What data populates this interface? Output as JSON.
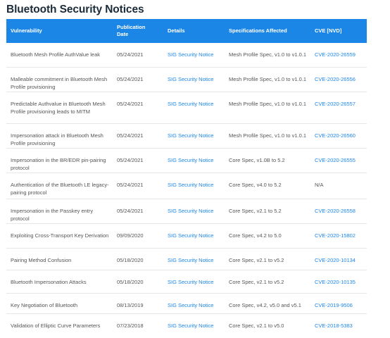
{
  "page": {
    "title": "Bluetooth Security Notices"
  },
  "table": {
    "headers": {
      "vulnerability": "Vulnerability",
      "publication_date": "Publication\nDate",
      "details": "Details",
      "specifications": "Specifications Affected",
      "cve": "CVE [NVD]"
    },
    "rows": [
      {
        "vulnerability": "Bluetooth Mesh Profile AuthValue leak",
        "date": "05/24/2021",
        "details": "SIG Security Notice",
        "spec": "Mesh Profile Spec, v1.0 to v1.0.1",
        "cve": "CVE-2020-26559"
      },
      {
        "vulnerability": "Malleable commitment in Bluetooth Mesh Profile provisioning",
        "date": "05/24/2021",
        "details": "SIG Security Notice",
        "spec": "Mesh Profile Spec, v1.0 to v1.0.1",
        "cve": "CVE-2020-26556"
      },
      {
        "vulnerability": "Predictable Authvalue in Bluetooth Mesh Profile provisioning leads to MITM",
        "date": "05/24/2021",
        "details": "SIG Security Notice",
        "spec": "Mesh Profile Spec, v1.0 to v1.0.1",
        "cve": "CVE-2020-26557"
      },
      {
        "vulnerability": "Impersonation attack in Bluetooth Mesh Profile provisioning",
        "date": "05/24/2021",
        "details": "SIG Security Notice",
        "spec": "Mesh Profile Spec, v1.0 to v1.0.1",
        "cve": "CVE-2020-26560"
      },
      {
        "vulnerability": "Impersonation in the BR/EDR pin-pairing protocol",
        "date": "05/24/2021",
        "details": "SIG Security Notice",
        "spec": "Core Spec, v1.0B to 5.2",
        "cve": "CVE-2020-26555"
      },
      {
        "vulnerability": "Authentication of the Bluetooth LE legacy-pairing protocol",
        "date": "05/24/2021",
        "details": "SIG Security Notice",
        "spec": "Core Spec, v4.0 to 5.2",
        "cve": "N/A"
      },
      {
        "vulnerability": "Impersonation in the Passkey entry protocol",
        "date": "05/24/2021",
        "details": "SIG Security Notice",
        "spec": "Core Spec, v2.1 to 5.2",
        "cve": "CVE-2020-26558"
      },
      {
        "vulnerability": "Exploiting Cross-Transport Key Derivation",
        "date": "09/09/2020",
        "details": "SIG Security Notice",
        "spec": "Core Spec, v4.2 to 5.0",
        "cve": "CVE-2020-15802"
      },
      {
        "vulnerability": "Pairing Method Confusion",
        "date": "05/18/2020",
        "details": "SIG Security Notice",
        "spec": "Core Spec, v2.1 to v5.2",
        "cve": "CVE-2020-10134"
      },
      {
        "vulnerability": "Bluetooth Impersonation Attacks",
        "date": "05/18/2020",
        "details": "SIG Security Notice",
        "spec": "Core Spec, v2.1 to v5.2",
        "cve": "CVE-2020-10135"
      },
      {
        "vulnerability": "Key Negotiation of Bluetooth",
        "date": "08/13/2019",
        "details": "SIG Security Notice",
        "spec": "Core Spec, v4.2, v5.0 and v5.1",
        "cve": "CVE-2019-9506"
      },
      {
        "vulnerability": "Validation of Elliptic Curve Parameters",
        "date": "07/23/2018",
        "details": "SIG Security Notice",
        "spec": "Core Spec, v2.1 to v5.0",
        "cve": "CVE-2018-5383"
      }
    ]
  }
}
